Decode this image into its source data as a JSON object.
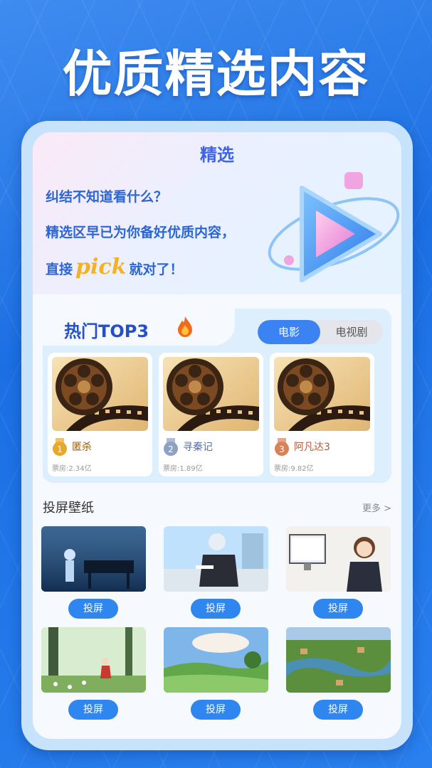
{
  "headline": "优质精选内容",
  "hero": {
    "title": "精选",
    "line1": "纠结不知道看什么？",
    "line2": "精选区早已为你备好优质内容，",
    "line3_pre": "直接",
    "line3_pick": "pick",
    "line3_post": "就对了！"
  },
  "top3": {
    "title": "热门TOP3",
    "tabs": [
      {
        "label": "电影",
        "active": true
      },
      {
        "label": "电视剧",
        "active": false
      }
    ],
    "movies": [
      {
        "rank": "1",
        "name": "匿杀",
        "box": "票房:2.34亿",
        "color": "#e7a82e"
      },
      {
        "rank": "2",
        "name": "寻秦记",
        "box": "票房:1.89亿",
        "color": "#8fa0c0"
      },
      {
        "rank": "3",
        "name": "阿凡达3",
        "box": "票房:9.82亿",
        "color": "#d8825a"
      }
    ]
  },
  "wallpapers": {
    "title": "投屏壁纸",
    "more": "更多 >",
    "cast_label": "投屏",
    "items": [
      "piano-scene",
      "boy-reading",
      "girl-computer",
      "forest-girl",
      "green-field",
      "river-village"
    ]
  }
}
